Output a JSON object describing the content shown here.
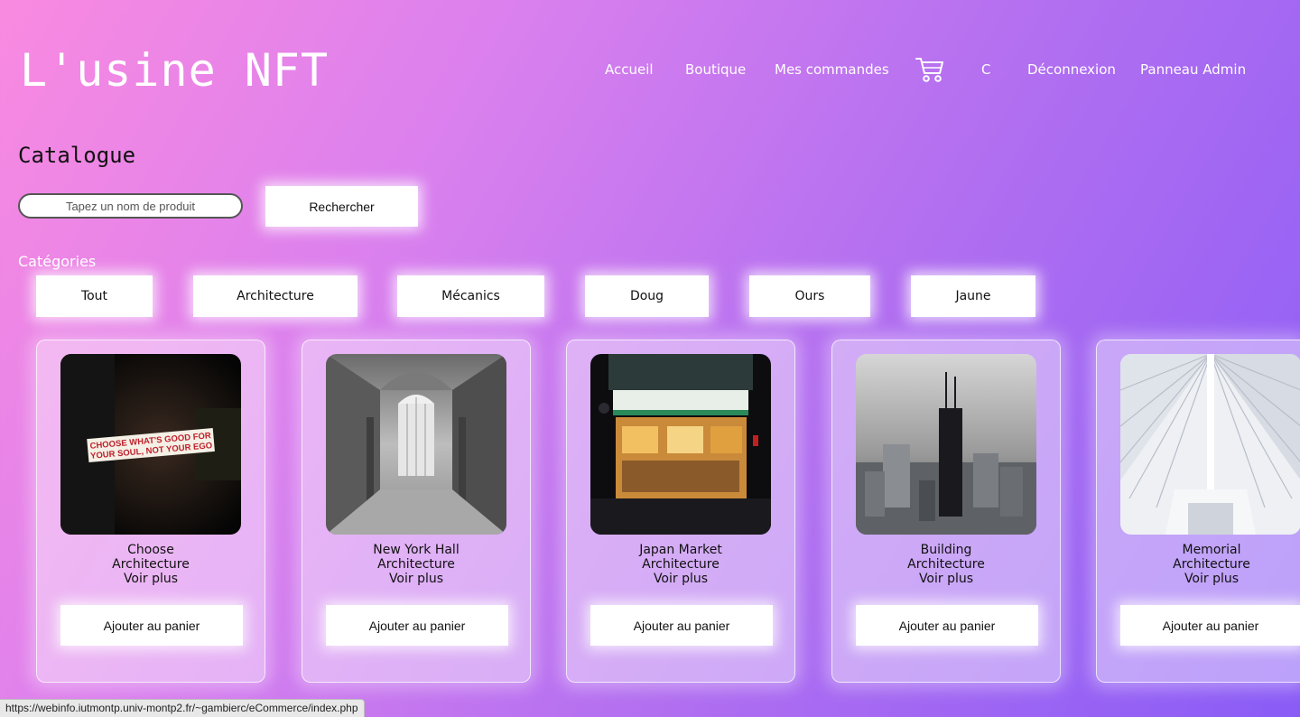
{
  "header": {
    "brand": "L'usine NFT",
    "nav": {
      "home": "Accueil",
      "shop": "Boutique",
      "orders": "Mes commandes",
      "user_initial": "C",
      "logout": "Déconnexion",
      "admin": "Panneau Admin"
    },
    "cart_icon": "cart-icon"
  },
  "catalog": {
    "title": "Catalogue",
    "search": {
      "placeholder": "Tapez un nom de produit",
      "value": "",
      "button_label": "Rechercher"
    },
    "categories_label": "Catégories",
    "categories": [
      "Tout",
      "Architecture",
      "Mécanics",
      "Doug",
      "Ours",
      "Jaune"
    ]
  },
  "products": [
    {
      "name": "Choose",
      "category": "Architecture",
      "more_label": "Voir plus",
      "add_label": "Ajouter au panier",
      "sign_text": [
        "CHOOSE WHAT'S GOOD FOR",
        "YOUR SOUL, NOT YOUR EGO"
      ]
    },
    {
      "name": "New York Hall",
      "category": "Architecture",
      "more_label": "Voir plus",
      "add_label": "Ajouter au panier"
    },
    {
      "name": "Japan Market",
      "category": "Architecture",
      "more_label": "Voir plus",
      "add_label": "Ajouter au panier"
    },
    {
      "name": "Building",
      "category": "Architecture",
      "more_label": "Voir plus",
      "add_label": "Ajouter au panier"
    },
    {
      "name": "Memorial",
      "category": "Architecture",
      "more_label": "Voir plus",
      "add_label": "Ajouter au panier"
    }
  ],
  "statusbar": {
    "url": "https://webinfo.iutmontp.univ-montp2.fr/~gambierc/eCommerce/index.php"
  },
  "colors": {
    "gradient_start": "#f98ae0",
    "gradient_end": "#8a5cf6",
    "card_bg": "rgba(255,255,255,0.42)",
    "button_bg": "#ffffff"
  }
}
